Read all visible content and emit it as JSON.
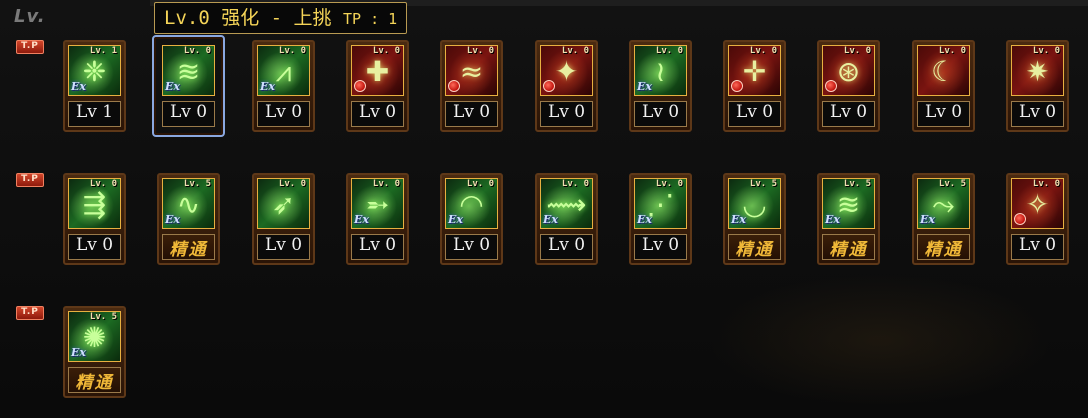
{
  "panel": {
    "lv_label": "Lv.",
    "tp_badge": "T.P"
  },
  "tooltip": {
    "level": "Lv.0",
    "name": "强化 - 上挑",
    "tp": "TP : 1"
  },
  "rows": [
    {
      "skills": [
        {
          "level_text": "Lv 1",
          "mini_level": "Lv. 1",
          "theme": "green",
          "mark": "ex",
          "glyph": "❈",
          "icon_name": "claw-strike-icon",
          "master": false,
          "selected": false
        },
        {
          "level_text": "Lv 0",
          "mini_level": "Lv. 0",
          "theme": "green",
          "mark": "ex",
          "glyph": "≋",
          "icon_name": "upward-slash-icon",
          "master": false,
          "selected": true
        },
        {
          "level_text": "Lv 0",
          "mini_level": "Lv. 0",
          "theme": "green",
          "mark": "ex",
          "glyph": "⩘",
          "icon_name": "triple-blade-icon",
          "master": false,
          "selected": false
        },
        {
          "level_text": "Lv 0",
          "mini_level": "Lv. 0",
          "theme": "red",
          "mark": "red",
          "glyph": "✚",
          "icon_name": "shield-cross-icon",
          "master": false,
          "selected": false
        },
        {
          "level_text": "Lv 0",
          "mini_level": "Lv. 0",
          "theme": "red",
          "mark": "red",
          "glyph": "≈",
          "icon_name": "wind-gust-icon",
          "master": false,
          "selected": false
        },
        {
          "level_text": "Lv 0",
          "mini_level": "Lv. 0",
          "theme": "red",
          "mark": "red",
          "glyph": "✦",
          "icon_name": "winged-burst-icon",
          "master": false,
          "selected": false
        },
        {
          "level_text": "Lv 0",
          "mini_level": "Lv. 0",
          "theme": "green",
          "mark": "ex",
          "glyph": "≀",
          "icon_name": "spiral-slash-icon",
          "master": false,
          "selected": false
        },
        {
          "level_text": "Lv 0",
          "mini_level": "Lv. 0",
          "theme": "red",
          "mark": "red",
          "glyph": "✛",
          "icon_name": "sword-plant-icon",
          "master": false,
          "selected": false
        },
        {
          "level_text": "Lv 0",
          "mini_level": "Lv. 0",
          "theme": "red",
          "mark": "red",
          "glyph": "⊛",
          "icon_name": "vortex-icon",
          "master": false,
          "selected": false
        },
        {
          "level_text": "Lv 0",
          "mini_level": "Lv. 0",
          "theme": "red",
          "mark": "none",
          "glyph": "☾",
          "icon_name": "crescent-slash-icon",
          "master": false,
          "selected": false
        },
        {
          "level_text": "Lv 0",
          "mini_level": "Lv. 0",
          "theme": "red",
          "mark": "none",
          "glyph": "✷",
          "icon_name": "burst-strike-icon",
          "master": false,
          "selected": false
        }
      ]
    },
    {
      "skills": [
        {
          "level_text": "Lv 0",
          "mini_level": "Lv. 0",
          "theme": "green",
          "mark": "none",
          "glyph": "⇶",
          "icon_name": "dash-slash-icon",
          "master": false,
          "selected": false
        },
        {
          "level_text": "精通",
          "mini_level": "Lv. 5",
          "theme": "green",
          "mark": "ex",
          "glyph": "∿",
          "icon_name": "wave-slash-icon",
          "master": true,
          "selected": false
        },
        {
          "level_text": "Lv 0",
          "mini_level": "Lv. 0",
          "theme": "green",
          "mark": "none",
          "glyph": "➶",
          "icon_name": "thrust-icon",
          "master": false,
          "selected": false
        },
        {
          "level_text": "Lv 0",
          "mini_level": "Lv. 0",
          "theme": "green",
          "mark": "ex",
          "glyph": "➵",
          "icon_name": "piercing-dash-icon",
          "master": false,
          "selected": false
        },
        {
          "level_text": "Lv 0",
          "mini_level": "Lv. 0",
          "theme": "green",
          "mark": "ex",
          "glyph": "◠",
          "icon_name": "arc-slash-icon",
          "master": false,
          "selected": false
        },
        {
          "level_text": "Lv 0",
          "mini_level": "Lv. 0",
          "theme": "green",
          "mark": "ex",
          "glyph": "⟿",
          "icon_name": "sweep-slash-icon",
          "master": false,
          "selected": false
        },
        {
          "level_text": "Lv 0",
          "mini_level": "Lv. 0",
          "theme": "green",
          "mark": "ex",
          "glyph": "⋰",
          "icon_name": "rising-slash-icon",
          "master": false,
          "selected": false
        },
        {
          "level_text": "精通",
          "mini_level": "Lv. 5",
          "theme": "green",
          "mark": "ex",
          "glyph": "◡",
          "icon_name": "crescent-wave-icon",
          "master": true,
          "selected": false
        },
        {
          "level_text": "精通",
          "mini_level": "Lv. 5",
          "theme": "green",
          "mark": "ex",
          "glyph": "≋",
          "icon_name": "triple-wave-icon",
          "master": true,
          "selected": false
        },
        {
          "level_text": "精通",
          "mini_level": "Lv. 5",
          "theme": "green",
          "mark": "ex",
          "glyph": "⤳",
          "icon_name": "curve-slash-icon",
          "master": true,
          "selected": false
        },
        {
          "level_text": "Lv 0",
          "mini_level": "Lv. 0",
          "theme": "red",
          "mark": "red",
          "glyph": "✧",
          "icon_name": "light-pillar-icon",
          "master": false,
          "selected": false
        }
      ]
    },
    {
      "skills": [
        {
          "level_text": "精通",
          "mini_level": "Lv. 5",
          "theme": "green",
          "mark": "ex",
          "glyph": "✺",
          "icon_name": "energy-burst-icon",
          "master": true,
          "selected": false
        }
      ]
    }
  ]
}
